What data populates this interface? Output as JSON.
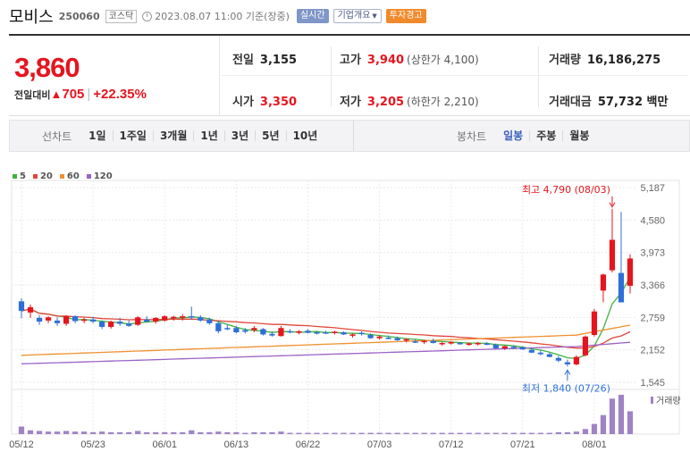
{
  "header": {
    "name": "모비스",
    "code": "250060",
    "market": "코스닥",
    "time": "2023.08.07 11:00 기준(장중)",
    "realtime_label": "실시간",
    "company_info_label": "기업개요",
    "warning_label": "투자경고"
  },
  "price": {
    "current": "3,860",
    "change_label": "전일대비",
    "change": "705",
    "change_pct": "+22.35%"
  },
  "stats": {
    "prev_close_label": "전일",
    "prev_close": "3,155",
    "open_label": "시가",
    "open": "3,350",
    "high_label": "고가",
    "high": "3,940",
    "upper_limit": "(상한가 4,100)",
    "low_label": "저가",
    "low": "3,205",
    "lower_limit": "(하한가 2,210)",
    "volume_label": "거래량",
    "volume": "16,186,275",
    "amount_label": "거래대금",
    "amount": "57,732 백만"
  },
  "toolbar": {
    "line_chart_label": "선차트",
    "periods": [
      "1일",
      "1주일",
      "3개월",
      "1년",
      "3년",
      "5년",
      "10년"
    ],
    "candle_label": "봉차트",
    "candle_periods": [
      "일봉",
      "주봉",
      "월봉"
    ],
    "active_candle_period": "일봉"
  },
  "legend": [
    {
      "label": "5",
      "color": "#3fb23f"
    },
    {
      "label": "20",
      "color": "#e0473a"
    },
    {
      "label": "60",
      "color": "#f0902e"
    },
    {
      "label": "120",
      "color": "#9b62c6"
    }
  ],
  "colors": {
    "up": "#e5151f",
    "down": "#2e6fd8",
    "accent": "#3a5fbd"
  },
  "chart_data": {
    "type": "candlestick",
    "y_ticks": [
      "5,187",
      "4,580",
      "3,973",
      "3,366",
      "2,759",
      "2,152",
      "1,545"
    ],
    "ylim": [
      1545,
      5187
    ],
    "x_ticks": [
      "05/12",
      "05/23",
      "06/01",
      "06/13",
      "06/22",
      "07/03",
      "07/12",
      "07/21",
      "08/01"
    ],
    "annotation_high": "최고 4,790 (08/03)",
    "annotation_low": "최저 1,840 (07/26)",
    "volume_label": "거래량",
    "candles": [
      [
        3060,
        3120,
        2740,
        2880
      ],
      [
        2850,
        3000,
        2750,
        2950
      ],
      [
        2750,
        2800,
        2620,
        2680
      ],
      [
        2700,
        2780,
        2650,
        2760
      ],
      [
        2700,
        2760,
        2600,
        2650
      ],
      [
        2640,
        2800,
        2600,
        2780
      ],
      [
        2780,
        2800,
        2650,
        2690
      ],
      [
        2700,
        2750,
        2650,
        2720
      ],
      [
        2720,
        2770,
        2650,
        2680
      ],
      [
        2680,
        2700,
        2540,
        2580
      ],
      [
        2580,
        2700,
        2550,
        2680
      ],
      [
        2680,
        2750,
        2600,
        2640
      ],
      [
        2640,
        2700,
        2580,
        2600
      ],
      [
        2620,
        2780,
        2600,
        2760
      ],
      [
        2720,
        2780,
        2660,
        2680
      ],
      [
        2680,
        2760,
        2640,
        2750
      ],
      [
        2700,
        2800,
        2680,
        2780
      ],
      [
        2740,
        2790,
        2700,
        2770
      ],
      [
        2770,
        2820,
        2700,
        2780
      ],
      [
        2780,
        2960,
        2720,
        2760
      ],
      [
        2760,
        2800,
        2680,
        2700
      ],
      [
        2720,
        2750,
        2620,
        2650
      ],
      [
        2650,
        2700,
        2460,
        2500
      ],
      [
        2560,
        2620,
        2520,
        2540
      ],
      [
        2560,
        2600,
        2460,
        2480
      ],
      [
        2520,
        2560,
        2460,
        2490
      ],
      [
        2520,
        2600,
        2480,
        2560
      ],
      [
        2540,
        2560,
        2420,
        2440
      ],
      [
        2450,
        2500,
        2400,
        2420
      ],
      [
        2410,
        2600,
        2400,
        2560
      ],
      [
        2500,
        2540,
        2460,
        2480
      ],
      [
        2470,
        2520,
        2440,
        2500
      ],
      [
        2510,
        2540,
        2460,
        2470
      ],
      [
        2480,
        2500,
        2440,
        2460
      ],
      [
        2480,
        2510,
        2450,
        2470
      ],
      [
        2470,
        2510,
        2440,
        2490
      ],
      [
        2480,
        2500,
        2430,
        2440
      ],
      [
        2420,
        2460,
        2380,
        2440
      ],
      [
        2470,
        2500,
        2420,
        2450
      ],
      [
        2430,
        2460,
        2360,
        2370
      ],
      [
        2370,
        2420,
        2340,
        2400
      ],
      [
        2380,
        2420,
        2350,
        2360
      ],
      [
        2370,
        2400,
        2320,
        2330
      ],
      [
        2330,
        2370,
        2290,
        2350
      ],
      [
        2310,
        2350,
        2280,
        2300
      ],
      [
        2300,
        2340,
        2260,
        2320
      ],
      [
        2320,
        2360,
        2270,
        2280
      ],
      [
        2260,
        2300,
        2230,
        2280
      ],
      [
        2270,
        2310,
        2250,
        2300
      ],
      [
        2280,
        2300,
        2250,
        2260
      ],
      [
        2260,
        2290,
        2230,
        2270
      ],
      [
        2260,
        2300,
        2230,
        2280
      ],
      [
        2270,
        2300,
        2240,
        2260
      ],
      [
        2250,
        2270,
        2170,
        2180
      ],
      [
        2180,
        2230,
        2150,
        2220
      ],
      [
        2210,
        2240,
        2170,
        2190
      ],
      [
        2200,
        2220,
        2150,
        2160
      ],
      [
        2150,
        2180,
        2090,
        2100
      ],
      [
        2100,
        2140,
        2050,
        2070
      ],
      [
        2070,
        2100,
        2010,
        2020
      ],
      [
        2000,
        2040,
        1920,
        1950
      ],
      [
        1920,
        1970,
        1840,
        1880
      ],
      [
        1880,
        2050,
        1860,
        2020
      ],
      [
        2050,
        2420,
        2030,
        2400
      ],
      [
        2430,
        2920,
        2400,
        2870
      ],
      [
        3260,
        3580,
        3040,
        3560
      ],
      [
        3640,
        4790,
        3600,
        4210
      ],
      [
        3590,
        4730,
        3050,
        3040
      ],
      [
        3350,
        3940,
        3205,
        3860
      ]
    ],
    "volume": [
      1.2,
      0.6,
      0.5,
      0.4,
      0.4,
      0.5,
      0.4,
      0.4,
      0.3,
      0.4,
      0.3,
      0.3,
      0.3,
      0.5,
      0.3,
      0.3,
      0.3,
      0.3,
      0.3,
      0.6,
      0.3,
      0.3,
      0.4,
      0.3,
      0.3,
      0.2,
      0.3,
      0.3,
      0.3,
      0.4,
      0.2,
      0.2,
      0.2,
      0.2,
      0.2,
      0.2,
      0.2,
      0.2,
      0.2,
      0.2,
      0.2,
      0.2,
      0.2,
      0.2,
      0.2,
      0.2,
      0.2,
      0.2,
      0.2,
      0.2,
      0.2,
      0.2,
      0.2,
      0.2,
      0.2,
      0.2,
      0.2,
      0.2,
      0.2,
      0.2,
      0.3,
      0.3,
      0.4,
      0.8,
      1.6,
      3.0,
      5.6,
      6.2,
      3.6
    ]
  }
}
